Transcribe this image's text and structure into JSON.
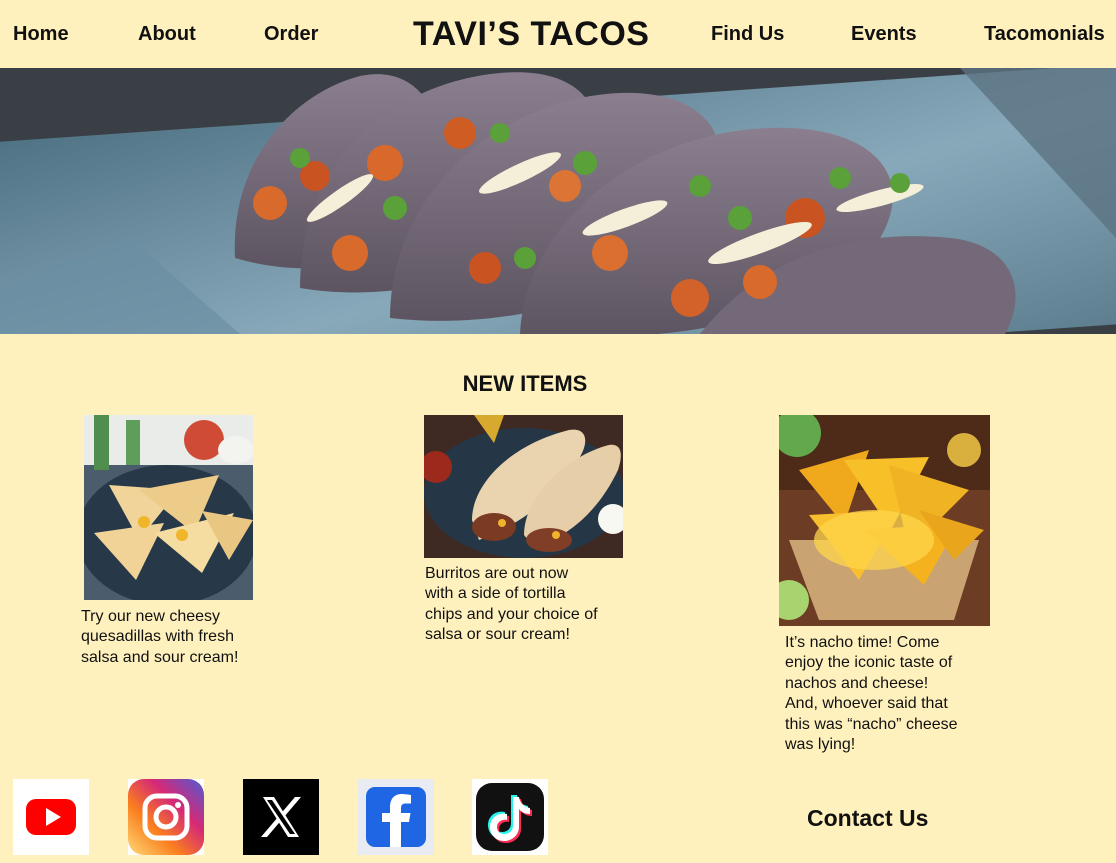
{
  "nav": {
    "home": "Home",
    "about": "About",
    "order": "Order",
    "brand": "TAVI’S TACOS",
    "find_us": "Find Us",
    "events": "Events",
    "tacomonials": "Tacomonials"
  },
  "main": {
    "section_title": "NEW ITEMS",
    "items": [
      {
        "image": "quesadillas-photo",
        "lines": [
          "Try our new cheesy",
          "quesadillas with fresh",
          "salsa and sour cream!"
        ]
      },
      {
        "image": "burritos-photo",
        "lines": [
          "Burritos are out now",
          "with a side of tortilla",
          "chips and your choice of",
          "salsa or sour cream!"
        ]
      },
      {
        "image": "nachos-photo",
        "lines": [
          "It’s nacho time! Come",
          "enjoy the iconic taste of",
          "nachos and cheese!",
          "And, whoever said that",
          "this was “nacho” cheese",
          "was lying!"
        ]
      }
    ]
  },
  "footer": {
    "social": [
      {
        "name": "youtube-icon"
      },
      {
        "name": "instagram-icon"
      },
      {
        "name": "x-icon"
      },
      {
        "name": "facebook-icon"
      },
      {
        "name": "tiktok-icon"
      }
    ],
    "contact": "Contact Us"
  },
  "colors": {
    "background": "#fff1bd",
    "youtube": "#ff0000",
    "facebook": "#1f66e5",
    "x": "#000000",
    "tiktok_cyan": "#25f4ee",
    "tiktok_pink": "#fe2c55"
  }
}
